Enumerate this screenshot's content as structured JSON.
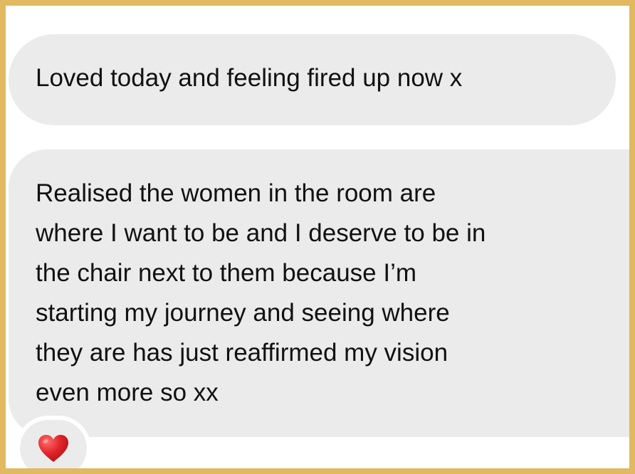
{
  "messages": [
    {
      "lines": [
        "Loved today and feeling fired up now x"
      ]
    },
    {
      "lines": [
        "Realised the women in the room are",
        "where I want to be and I deserve to be in",
        "the chair next to them because I’m",
        "starting my journey and seeing where",
        "they are has just reaffirmed my vision",
        "even more so xx"
      ]
    }
  ],
  "reaction": {
    "icon": "red-heart-icon",
    "color": "#e0242a"
  },
  "frame_color": "#e0b960",
  "bubble_color": "#ebebeb"
}
